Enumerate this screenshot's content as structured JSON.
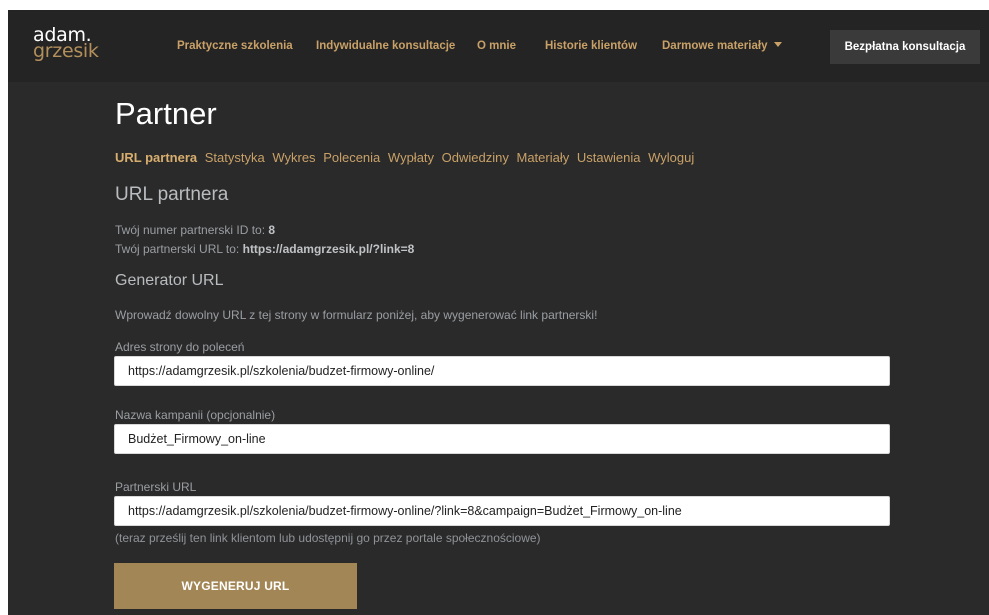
{
  "header": {
    "logo_line1": "adam.",
    "logo_line2": "grzesik",
    "nav": [
      {
        "label": "Praktyczne szkolenia"
      },
      {
        "label": "Indywidualne konsultacje"
      },
      {
        "label": "O mnie"
      },
      {
        "label": "Historie klientów"
      },
      {
        "label": "Darmowe materiały"
      }
    ],
    "cta_label": "Bezpłatna konsultacja"
  },
  "page": {
    "title": "Partner",
    "subnav": [
      {
        "label": "URL partnera",
        "active": true
      },
      {
        "label": "Statystyka"
      },
      {
        "label": "Wykres"
      },
      {
        "label": "Polecenia"
      },
      {
        "label": "Wypłaty"
      },
      {
        "label": "Odwiedziny"
      },
      {
        "label": "Materiały"
      },
      {
        "label": "Ustawienia"
      },
      {
        "label": "Wyloguj"
      }
    ],
    "section_title": "URL partnera",
    "id_text": "Twój numer partnerski ID to: ",
    "id_value": "8",
    "url_text": "Twój partnerski URL to: ",
    "url_value": "https://adamgrzesik.pl/?link=8",
    "generator_title": "Generator URL",
    "generator_intro": "Wprowadź dowolny URL z tej strony w formularz poniżej, aby wygenerować link partnerski!",
    "fields": [
      {
        "label": "Adres strony do poleceń",
        "value": "https://adamgrzesik.pl/szkolenia/budzet-firmowy-online/"
      },
      {
        "label": "Nazwa kampanii (opcjonalnie)",
        "value": "Budżet_Firmowy_on-line"
      },
      {
        "label": "Partnerski URL",
        "value": "https://adamgrzesik.pl/szkolenia/budzet-firmowy-online/?link=8&campaign=Budżet_Firmowy_on-line"
      }
    ],
    "help_text": "(teraz prześlij ten link klientom lub udostępnij go przez portale społecznościowe)",
    "generate_button": "WYGENERUJ URL"
  },
  "colors": {
    "background": "#2a2a2a",
    "header": "#242424",
    "accent": "#c9a168",
    "button": "#a38655"
  }
}
